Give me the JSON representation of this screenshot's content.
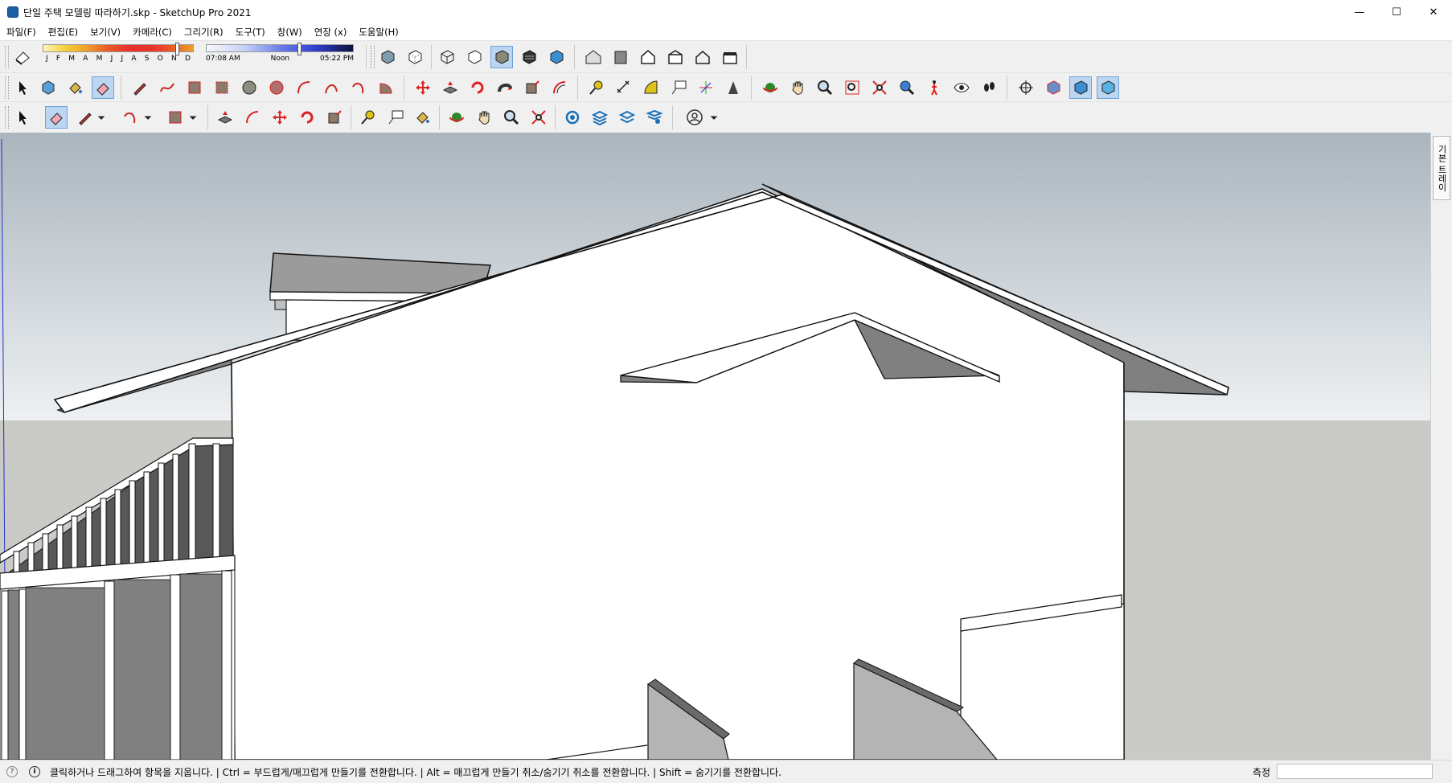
{
  "window": {
    "title": "단일 주택 모델링 따라하기.skp - SketchUp Pro 2021",
    "minimize_glyph": "—",
    "maximize_glyph": "☐",
    "close_glyph": "✕"
  },
  "menu": [
    "파일(F)",
    "편집(E)",
    "보기(V)",
    "카메라(C)",
    "그리기(R)",
    "도구(T)",
    "창(W)",
    "연장 (x)",
    "도움말(H)"
  ],
  "shadow": {
    "months": [
      "J",
      "F",
      "M",
      "A",
      "M",
      "J",
      "J",
      "A",
      "S",
      "O",
      "N",
      "D"
    ],
    "month_position": 0.88,
    "time_start": "07:08 AM",
    "time_mid": "Noon",
    "time_end": "05:22 PM",
    "time_position": 0.62
  },
  "right_tray": {
    "label": "기본 트레이"
  },
  "status": {
    "info_icon": "i",
    "message": "클릭하거나 드래그하여 항목을 지웁니다. | Ctrl = 부드럽게/매끄럽게 만들기를 전환합니다. | Alt = 매끄럽게 만들기 취소/숨기기 취소를 전환합니다. | Shift = 숨기기를 전환합니다.",
    "measure_label": "측정",
    "measure_value": ""
  },
  "colors": {
    "sky_top": "#aab5bd",
    "sky_bottom": "#eef1f3",
    "ground": "#cacac6",
    "face_white": "#ffffff",
    "face_shade": "#808080",
    "accent_active": "#bcd6f2"
  }
}
